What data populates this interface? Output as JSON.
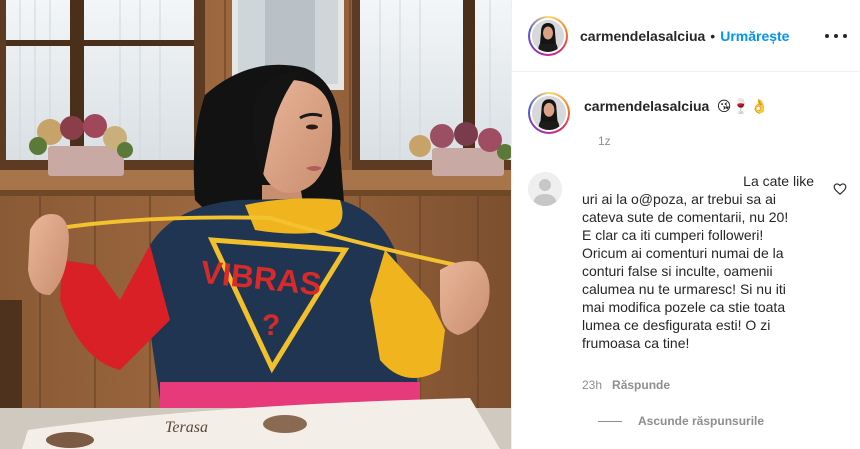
{
  "post": {
    "username": "carmendelasalciua",
    "separator": "•",
    "follow_label": "Urmărește",
    "more_icon": "more-options-icon"
  },
  "caption": {
    "username": "carmendelasalciua",
    "emojis": "😘🍷👌",
    "time": "1z"
  },
  "comment": {
    "text_lines": [
      "La cate like",
      "uri ai la o@poza, ar trebui sa ai",
      "cateva sute de comentarii, nu 20!",
      "E clar ca iti cumperi followeri!",
      "Oricum ai comenturi numai de la",
      "conturi false si inculte, oamenii",
      "calumea nu te urmaresc! Si nu iti",
      "mai modifica pozele ca stie toata",
      "lumea ce desfigurata esti! O zi",
      "frumoasa ca tine!"
    ],
    "time": "23h",
    "reply_label": "Răspunde",
    "hide_replies_label": "Ascunde răspunsurile"
  },
  "photo": {
    "sweatshirt_text": "VIBRAS",
    "sweatshirt_mark": "?",
    "table_sign_text": "Terasa"
  },
  "colors": {
    "accent": "#0095f6",
    "text": "#262626",
    "secondary": "#8e8e8e"
  }
}
